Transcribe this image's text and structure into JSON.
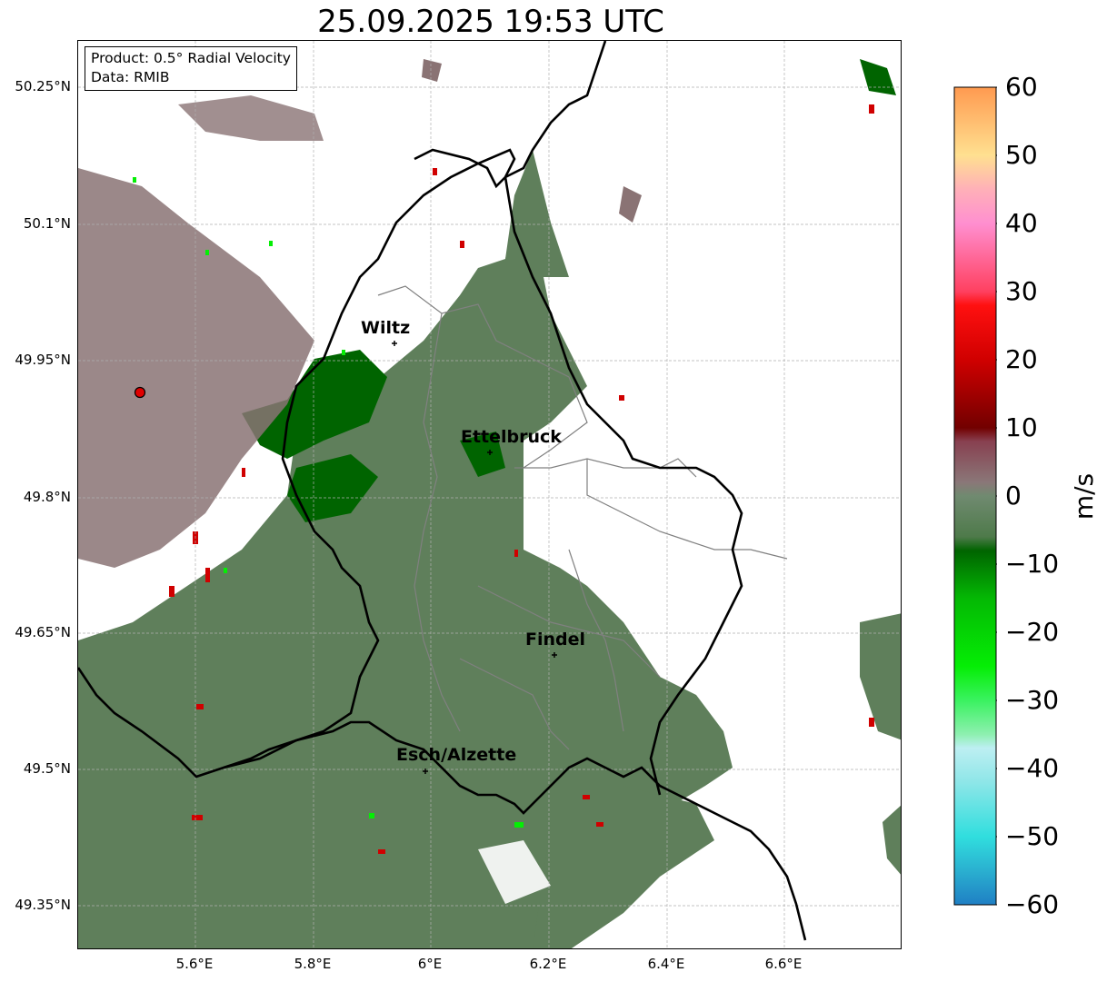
{
  "title": "25.09.2025 19:53 UTC",
  "info": {
    "product": "Product: 0.5° Radial Velocity",
    "data": "Data: RMIB"
  },
  "lat_ticks": [
    {
      "label": "50.25°N",
      "value": 50.25
    },
    {
      "label": "50.1°N",
      "value": 50.1
    },
    {
      "label": "49.95°N",
      "value": 49.95
    },
    {
      "label": "49.8°N",
      "value": 49.8
    },
    {
      "label": "49.65°N",
      "value": 49.65
    },
    {
      "label": "49.5°N",
      "value": 49.5
    },
    {
      "label": "49.35°N",
      "value": 49.35
    }
  ],
  "lon_ticks": [
    {
      "label": "5.6°E",
      "value": 5.6
    },
    {
      "label": "5.8°E",
      "value": 5.8
    },
    {
      "label": "6°E",
      "value": 6.0
    },
    {
      "label": "6.2°E",
      "value": 6.2
    },
    {
      "label": "6.4°E",
      "value": 6.4
    },
    {
      "label": "6.6°E",
      "value": 6.6
    }
  ],
  "extent": {
    "lon_min": 5.4,
    "lon_max": 6.8,
    "lat_min": 49.32,
    "lat_max": 50.3
  },
  "radar_site": {
    "lon": 5.505,
    "lat": 49.914
  },
  "cities": [
    {
      "name": "Wiltz",
      "lon": 5.93,
      "lat": 49.966
    },
    {
      "name": "Ettelbruck",
      "lon": 6.104,
      "lat": 49.847
    },
    {
      "name": "Findel",
      "lon": 6.21,
      "lat": 49.626
    },
    {
      "name": "Esch/Alzette",
      "lon": 5.98,
      "lat": 49.498
    }
  ],
  "colorbar": {
    "label": "m/s",
    "min": -60,
    "max": 60,
    "tick_labels": [
      "60",
      "50",
      "40",
      "30",
      "20",
      "10",
      "0",
      "−10",
      "−20",
      "−30",
      "−40",
      "−50",
      "−60"
    ],
    "tick_values": [
      60,
      50,
      40,
      30,
      20,
      10,
      0,
      -10,
      -20,
      -30,
      -40,
      -50,
      -60
    ],
    "stops": [
      {
        "v": -60,
        "color": "#1f7fc4"
      },
      {
        "v": -55,
        "color": "#2ab0d0"
      },
      {
        "v": -50,
        "color": "#30dede"
      },
      {
        "v": -42,
        "color": "#8ee6e8"
      },
      {
        "v": -37,
        "color": "#bdeff2"
      },
      {
        "v": -35,
        "color": "#8ef0b0"
      },
      {
        "v": -30,
        "color": "#3af260"
      },
      {
        "v": -25,
        "color": "#05ee05"
      },
      {
        "v": -15,
        "color": "#04b804"
      },
      {
        "v": -8,
        "color": "#006400"
      },
      {
        "v": -6,
        "color": "#4e7a4a"
      },
      {
        "v": 0,
        "color": "#708a70"
      },
      {
        "v": 2,
        "color": "#8a7778"
      },
      {
        "v": 8,
        "color": "#884050"
      },
      {
        "v": 10,
        "color": "#720000"
      },
      {
        "v": 20,
        "color": "#d00000"
      },
      {
        "v": 28,
        "color": "#ff1010"
      },
      {
        "v": 30,
        "color": "#ff4060"
      },
      {
        "v": 40,
        "color": "#ff8fd0"
      },
      {
        "v": 45,
        "color": "#ffb0b8"
      },
      {
        "v": 50,
        "color": "#ffe090"
      },
      {
        "v": 60,
        "color": "#ff9a50"
      }
    ]
  },
  "colors": {
    "velocity_dominant": "#5f7f5b",
    "velocity_strong_inbound": "#006400",
    "velocity_near_zero_outbound": "#8a7374",
    "velocity_outbound_red": "#d00000",
    "border": "#000000",
    "canton_border": "#808080",
    "grid": "#b0b0b0",
    "radar_marker": "#e00000"
  }
}
